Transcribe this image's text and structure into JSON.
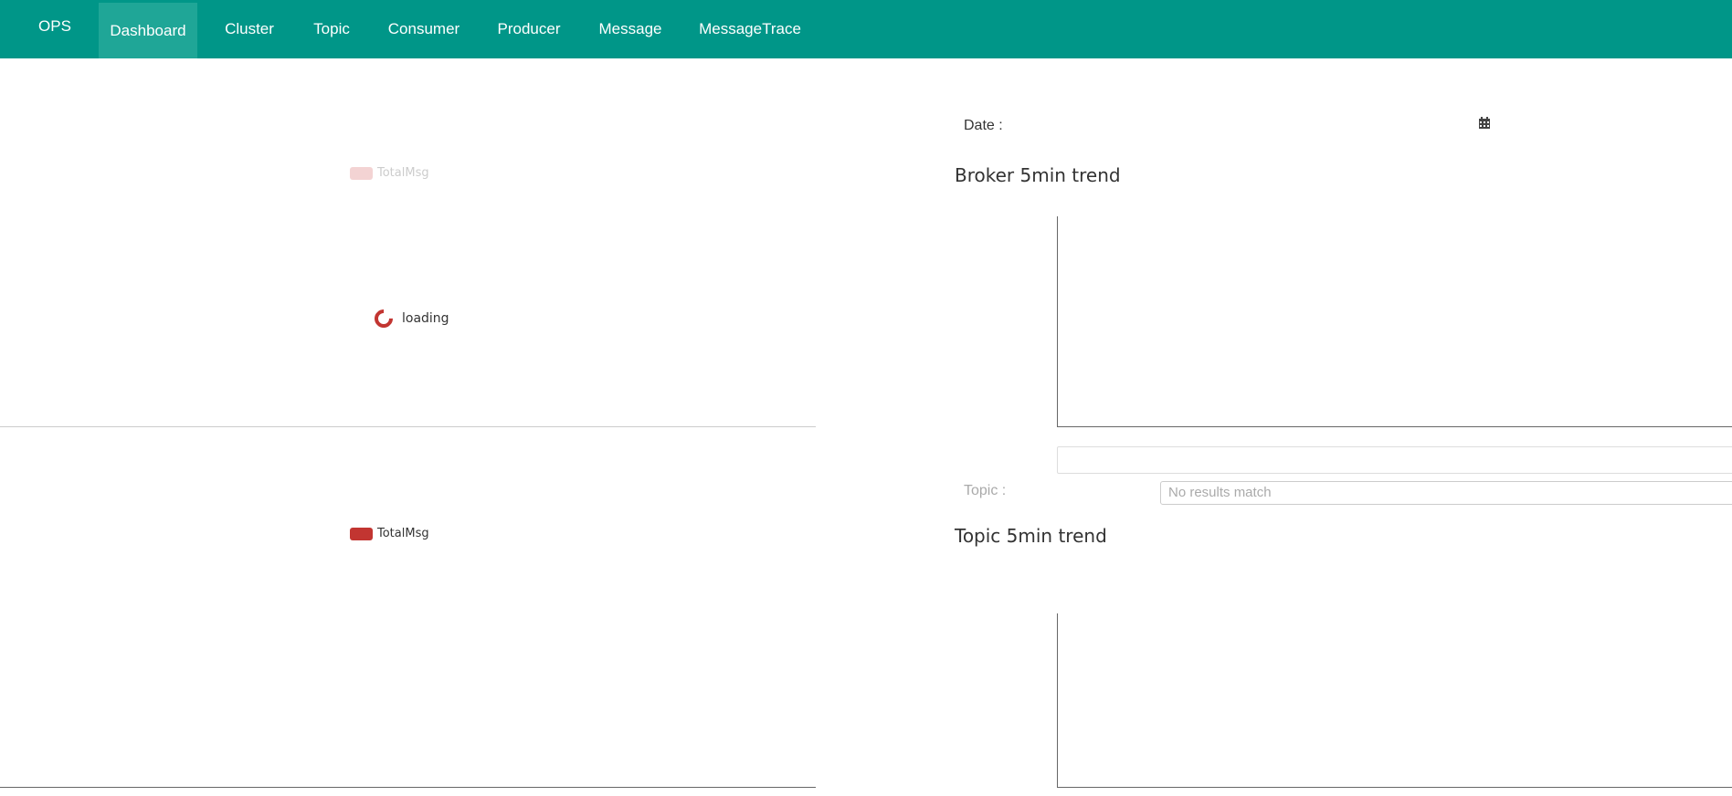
{
  "navbar": {
    "brand": "OPS",
    "items": [
      {
        "label": "Dashboard",
        "active": true
      },
      {
        "label": "Cluster"
      },
      {
        "label": "Topic"
      },
      {
        "label": "Consumer"
      },
      {
        "label": "Producer"
      },
      {
        "label": "Message"
      },
      {
        "label": "MessageTrace"
      }
    ],
    "background": "#009688"
  },
  "left_top_chart": {
    "legend": "TotalMsg",
    "loading_text": "loading"
  },
  "left_bottom_chart": {
    "legend": "TotalMsg"
  },
  "right": {
    "date_label": "Date :",
    "calendar_icon": "calendar-icon",
    "broker_title": "Broker 5min trend",
    "topic_label": "Topic :",
    "topic_select_text": "No results match",
    "topic_title": "Topic 5min trend"
  },
  "colors": {
    "series": "#c23531",
    "series_faded": "#f3d3d3"
  }
}
